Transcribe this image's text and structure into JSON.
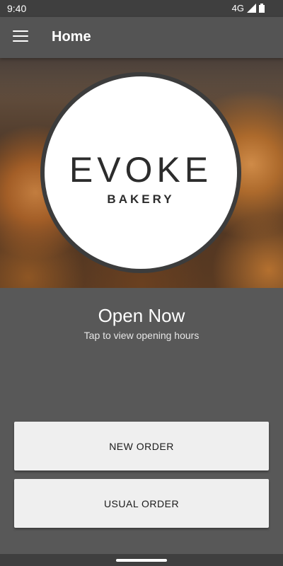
{
  "status_bar": {
    "time": "9:40",
    "network": "4G"
  },
  "app_bar": {
    "title": "Home"
  },
  "logo": {
    "brand": "EVOKE",
    "subtitle": "BAKERY"
  },
  "store_status": {
    "title": "Open Now",
    "hint": "Tap to view opening hours"
  },
  "buttons": {
    "new_order": "NEW ORDER",
    "usual_order": "USUAL ORDER"
  }
}
